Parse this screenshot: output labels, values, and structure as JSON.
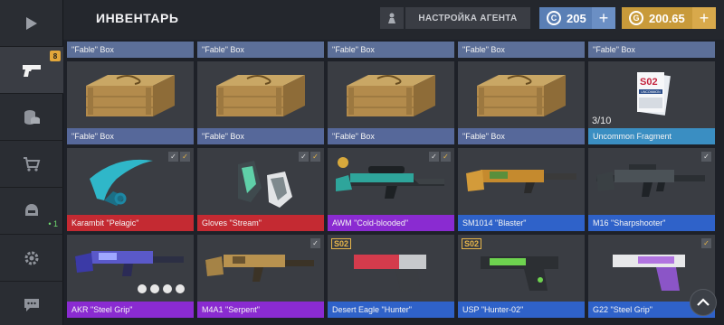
{
  "header": {
    "title": "ИНВЕНТАРЬ",
    "agent_button": "НАСТРОЙКА АГЕНТА",
    "currency_blue": "205",
    "currency_gold": "200.65",
    "plus": "+"
  },
  "sidebar": {
    "badge": "8",
    "count": "1"
  },
  "top_strip": [
    "\"Fable\" Box",
    "\"Fable\" Box",
    "\"Fable\" Box",
    "\"Fable\" Box",
    "\"Fable\" Box"
  ],
  "row1": [
    {
      "label": "\"Fable\" Box",
      "icon": "crate-icon"
    },
    {
      "label": "\"Fable\" Box",
      "icon": "crate-icon"
    },
    {
      "label": "\"Fable\" Box",
      "icon": "crate-icon"
    },
    {
      "label": "\"Fable\" Box",
      "icon": "crate-icon"
    },
    {
      "label": "Uncommon Fragment",
      "icon": "fragment-card-icon",
      "fraction": "3/10",
      "tag": "S02",
      "card_text": "UNCOMMON"
    }
  ],
  "row2": [
    {
      "label": "Karambit \"Pelagic\"",
      "icon": "karambit-icon"
    },
    {
      "label": "Gloves \"Stream\"",
      "icon": "gloves-icon"
    },
    {
      "label": "AWM \"Cold-blooded\"",
      "icon": "sniper-rifle-icon"
    },
    {
      "label": "SM1014 \"Blaster\"",
      "icon": "shotgun-icon"
    },
    {
      "label": "M16 \"Sharpshooter\"",
      "icon": "rifle-icon"
    }
  ],
  "row3": [
    {
      "label": "AKR \"Steel Grip\"",
      "icon": "rifle-icon"
    },
    {
      "label": "M4A1 \"Serpent\"",
      "icon": "rifle-icon"
    },
    {
      "label": "Desert Eagle \"Hunter\"",
      "icon": "pistol-icon",
      "tag": "S02"
    },
    {
      "label": "USP \"Hunter-02\"",
      "icon": "pistol-icon",
      "tag": "S02"
    },
    {
      "label": "G22 \"Steel Grip\"",
      "icon": "pistol-icon"
    }
  ],
  "colors": {
    "rarity_common": "#56689a",
    "rarity_red": "#c42a32",
    "rarity_purple": "#8a2bd1",
    "rarity_blue": "#2f62c9",
    "rarity_lightblue": "#3a8ec2",
    "gold": "#c89a3a",
    "blue_currency": "#5a7fb5"
  }
}
